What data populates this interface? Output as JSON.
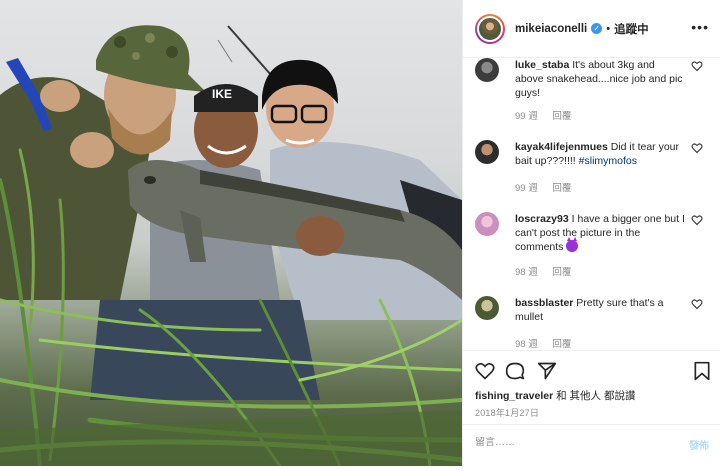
{
  "header": {
    "username": "mikeiaconelli",
    "verified_mark": "✓",
    "separator": "•",
    "follow_label": "追蹤中",
    "more_icon": "ellipsis-icon"
  },
  "photo": {
    "cap_text": "IKE"
  },
  "comments": [
    {
      "username": "luke_staba",
      "text": "It's about 3kg and above snakehead....nice job and pic guys!",
      "age": "99 週",
      "reply_label": "回覆"
    },
    {
      "username": "kayak4lifejenmues",
      "text": "Did it tear your bait up???!!!! ",
      "hashtag": "#slimymofos",
      "age": "99 週",
      "reply_label": "回覆"
    },
    {
      "username": "loscrazy93",
      "text": "I have a bigger one but I can't post the picture in the comments ",
      "emoji": "smiling-devil-emoji",
      "age": "98 週",
      "reply_label": "回覆"
    },
    {
      "username": "bassblaster",
      "text": "Pretty sure that's a mullet",
      "age": "98 週",
      "reply_label": "回覆"
    }
  ],
  "actions": {
    "like_icon": "heart-icon",
    "comment_icon": "speech-bubble-icon",
    "share_icon": "paper-plane-icon",
    "save_icon": "bookmark-icon"
  },
  "likes": {
    "user": "fishing_traveler",
    "rest": " 和 其他人 都說讚"
  },
  "post_date": "2018年1月27日",
  "comment_box": {
    "placeholder": "留言……",
    "post_label": "發佈"
  }
}
